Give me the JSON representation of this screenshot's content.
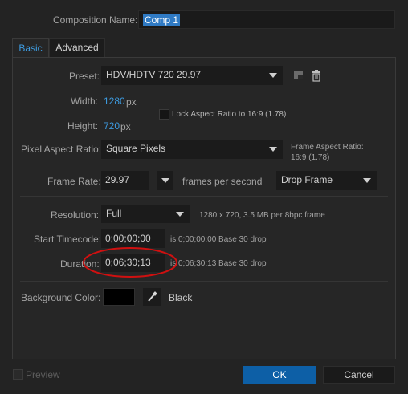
{
  "composition_name": {
    "label": "Composition Name:",
    "value": "Comp 1"
  },
  "tabs": {
    "basic": "Basic",
    "advanced": "Advanced"
  },
  "preset": {
    "label": "Preset:",
    "value": "HDV/HDTV 720 29.97"
  },
  "width": {
    "label": "Width:",
    "value": "1280",
    "unit": "px"
  },
  "height": {
    "label": "Height:",
    "value": "720",
    "unit": "px"
  },
  "lock_aspect": {
    "label": "Lock Aspect Ratio to 16:9 (1.78)",
    "checked": false
  },
  "pixel_aspect": {
    "label": "Pixel Aspect Ratio:",
    "value": "Square Pixels"
  },
  "frame_aspect": {
    "line1": "Frame Aspect Ratio:",
    "line2": "16:9 (1.78)"
  },
  "frame_rate": {
    "label": "Frame Rate:",
    "value": "29.97",
    "unit_label": "frames per second",
    "drop": "Drop Frame"
  },
  "resolution": {
    "label": "Resolution:",
    "value": "Full",
    "info": "1280 x 720, 3.5 MB per 8bpc frame"
  },
  "start_timecode": {
    "label": "Start Timecode:",
    "value": "0;00;00;00",
    "info": "is 0;00;00;00  Base 30  drop"
  },
  "duration": {
    "label": "Duration:",
    "value": "0;06;30;13",
    "info": "is 0;06;30;13  Base 30  drop"
  },
  "background": {
    "label": "Background Color:",
    "color_name": "Black",
    "swatch": "#000000"
  },
  "preview": {
    "label": "Preview"
  },
  "buttons": {
    "ok": "OK",
    "cancel": "Cancel"
  },
  "colors": {
    "accent": "#3d9be0",
    "annotation": "#d01010"
  }
}
